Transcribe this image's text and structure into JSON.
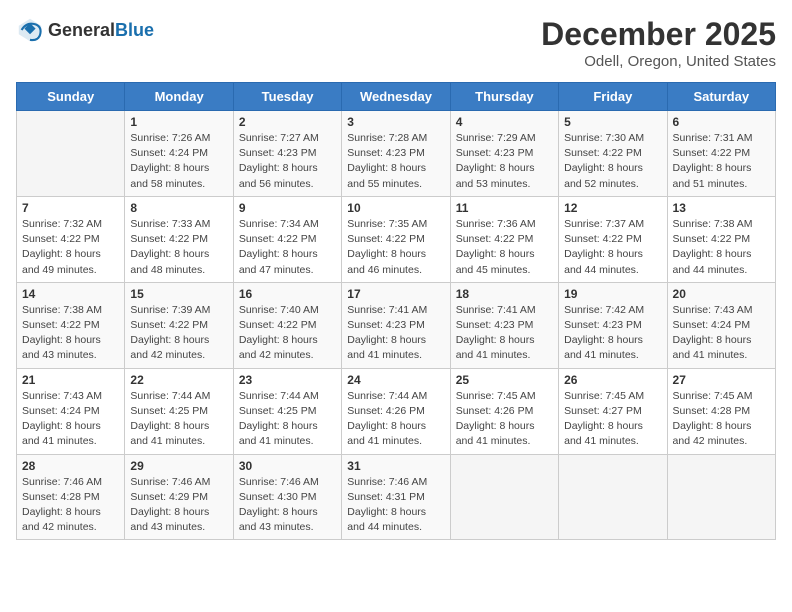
{
  "header": {
    "logo_general": "General",
    "logo_blue": "Blue",
    "title": "December 2025",
    "subtitle": "Odell, Oregon, United States"
  },
  "weekdays": [
    "Sunday",
    "Monday",
    "Tuesday",
    "Wednesday",
    "Thursday",
    "Friday",
    "Saturday"
  ],
  "weeks": [
    [
      {
        "day": "",
        "sunrise": "",
        "sunset": "",
        "daylight": ""
      },
      {
        "day": "1",
        "sunrise": "Sunrise: 7:26 AM",
        "sunset": "Sunset: 4:24 PM",
        "daylight": "Daylight: 8 hours and 58 minutes."
      },
      {
        "day": "2",
        "sunrise": "Sunrise: 7:27 AM",
        "sunset": "Sunset: 4:23 PM",
        "daylight": "Daylight: 8 hours and 56 minutes."
      },
      {
        "day": "3",
        "sunrise": "Sunrise: 7:28 AM",
        "sunset": "Sunset: 4:23 PM",
        "daylight": "Daylight: 8 hours and 55 minutes."
      },
      {
        "day": "4",
        "sunrise": "Sunrise: 7:29 AM",
        "sunset": "Sunset: 4:23 PM",
        "daylight": "Daylight: 8 hours and 53 minutes."
      },
      {
        "day": "5",
        "sunrise": "Sunrise: 7:30 AM",
        "sunset": "Sunset: 4:22 PM",
        "daylight": "Daylight: 8 hours and 52 minutes."
      },
      {
        "day": "6",
        "sunrise": "Sunrise: 7:31 AM",
        "sunset": "Sunset: 4:22 PM",
        "daylight": "Daylight: 8 hours and 51 minutes."
      }
    ],
    [
      {
        "day": "7",
        "sunrise": "Sunrise: 7:32 AM",
        "sunset": "Sunset: 4:22 PM",
        "daylight": "Daylight: 8 hours and 49 minutes."
      },
      {
        "day": "8",
        "sunrise": "Sunrise: 7:33 AM",
        "sunset": "Sunset: 4:22 PM",
        "daylight": "Daylight: 8 hours and 48 minutes."
      },
      {
        "day": "9",
        "sunrise": "Sunrise: 7:34 AM",
        "sunset": "Sunset: 4:22 PM",
        "daylight": "Daylight: 8 hours and 47 minutes."
      },
      {
        "day": "10",
        "sunrise": "Sunrise: 7:35 AM",
        "sunset": "Sunset: 4:22 PM",
        "daylight": "Daylight: 8 hours and 46 minutes."
      },
      {
        "day": "11",
        "sunrise": "Sunrise: 7:36 AM",
        "sunset": "Sunset: 4:22 PM",
        "daylight": "Daylight: 8 hours and 45 minutes."
      },
      {
        "day": "12",
        "sunrise": "Sunrise: 7:37 AM",
        "sunset": "Sunset: 4:22 PM",
        "daylight": "Daylight: 8 hours and 44 minutes."
      },
      {
        "day": "13",
        "sunrise": "Sunrise: 7:38 AM",
        "sunset": "Sunset: 4:22 PM",
        "daylight": "Daylight: 8 hours and 44 minutes."
      }
    ],
    [
      {
        "day": "14",
        "sunrise": "Sunrise: 7:38 AM",
        "sunset": "Sunset: 4:22 PM",
        "daylight": "Daylight: 8 hours and 43 minutes."
      },
      {
        "day": "15",
        "sunrise": "Sunrise: 7:39 AM",
        "sunset": "Sunset: 4:22 PM",
        "daylight": "Daylight: 8 hours and 42 minutes."
      },
      {
        "day": "16",
        "sunrise": "Sunrise: 7:40 AM",
        "sunset": "Sunset: 4:22 PM",
        "daylight": "Daylight: 8 hours and 42 minutes."
      },
      {
        "day": "17",
        "sunrise": "Sunrise: 7:41 AM",
        "sunset": "Sunset: 4:23 PM",
        "daylight": "Daylight: 8 hours and 41 minutes."
      },
      {
        "day": "18",
        "sunrise": "Sunrise: 7:41 AM",
        "sunset": "Sunset: 4:23 PM",
        "daylight": "Daylight: 8 hours and 41 minutes."
      },
      {
        "day": "19",
        "sunrise": "Sunrise: 7:42 AM",
        "sunset": "Sunset: 4:23 PM",
        "daylight": "Daylight: 8 hours and 41 minutes."
      },
      {
        "day": "20",
        "sunrise": "Sunrise: 7:43 AM",
        "sunset": "Sunset: 4:24 PM",
        "daylight": "Daylight: 8 hours and 41 minutes."
      }
    ],
    [
      {
        "day": "21",
        "sunrise": "Sunrise: 7:43 AM",
        "sunset": "Sunset: 4:24 PM",
        "daylight": "Daylight: 8 hours and 41 minutes."
      },
      {
        "day": "22",
        "sunrise": "Sunrise: 7:44 AM",
        "sunset": "Sunset: 4:25 PM",
        "daylight": "Daylight: 8 hours and 41 minutes."
      },
      {
        "day": "23",
        "sunrise": "Sunrise: 7:44 AM",
        "sunset": "Sunset: 4:25 PM",
        "daylight": "Daylight: 8 hours and 41 minutes."
      },
      {
        "day": "24",
        "sunrise": "Sunrise: 7:44 AM",
        "sunset": "Sunset: 4:26 PM",
        "daylight": "Daylight: 8 hours and 41 minutes."
      },
      {
        "day": "25",
        "sunrise": "Sunrise: 7:45 AM",
        "sunset": "Sunset: 4:26 PM",
        "daylight": "Daylight: 8 hours and 41 minutes."
      },
      {
        "day": "26",
        "sunrise": "Sunrise: 7:45 AM",
        "sunset": "Sunset: 4:27 PM",
        "daylight": "Daylight: 8 hours and 41 minutes."
      },
      {
        "day": "27",
        "sunrise": "Sunrise: 7:45 AM",
        "sunset": "Sunset: 4:28 PM",
        "daylight": "Daylight: 8 hours and 42 minutes."
      }
    ],
    [
      {
        "day": "28",
        "sunrise": "Sunrise: 7:46 AM",
        "sunset": "Sunset: 4:28 PM",
        "daylight": "Daylight: 8 hours and 42 minutes."
      },
      {
        "day": "29",
        "sunrise": "Sunrise: 7:46 AM",
        "sunset": "Sunset: 4:29 PM",
        "daylight": "Daylight: 8 hours and 43 minutes."
      },
      {
        "day": "30",
        "sunrise": "Sunrise: 7:46 AM",
        "sunset": "Sunset: 4:30 PM",
        "daylight": "Daylight: 8 hours and 43 minutes."
      },
      {
        "day": "31",
        "sunrise": "Sunrise: 7:46 AM",
        "sunset": "Sunset: 4:31 PM",
        "daylight": "Daylight: 8 hours and 44 minutes."
      },
      {
        "day": "",
        "sunrise": "",
        "sunset": "",
        "daylight": ""
      },
      {
        "day": "",
        "sunrise": "",
        "sunset": "",
        "daylight": ""
      },
      {
        "day": "",
        "sunrise": "",
        "sunset": "",
        "daylight": ""
      }
    ]
  ]
}
